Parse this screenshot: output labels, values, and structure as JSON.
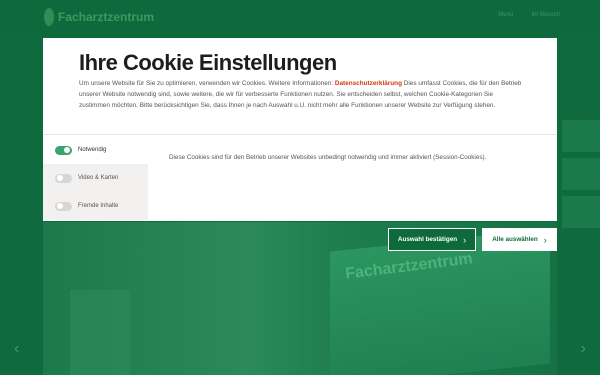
{
  "background": {
    "logo_text": "Facharztzentrum",
    "nav": [
      "Menü",
      "Ihr Besuch"
    ],
    "sign_text": "Facharztzentrum",
    "side_tabs": [
      "",
      "",
      ""
    ]
  },
  "modal": {
    "title": "Ihre Cookie Einstellungen",
    "desc_before_link": "Um unsere Website für Sie zu optimieren, verwenden wir Cookies. Weitere Informationen: ",
    "link_text": "Datenschutzerklärung",
    "desc_after_link": " Dies umfasst Cookies, die für den Betrieb unserer Website notwendig sind, sowie weitere, die wir für verbesserte Funktionen nutzen. Sie entscheiden selbst, welchen Cookie-Kategorien Sie zustimmen möchten. Bitte berücksichtigen Sie, dass Ihnen je nach Auswahl u.U. nicht mehr alle Funktionen unserer Website zur Verfügung stehen.",
    "categories": [
      {
        "label": "Notwendig",
        "enabled": true
      },
      {
        "label": "Video & Karten",
        "enabled": false
      },
      {
        "label": "Fremde Inhalte",
        "enabled": false
      }
    ],
    "detail_text": "Diese Cookies sind für den Betrieb unserer Websites unbedingt notwendig und immer aktiviert (Session-Cookies)."
  },
  "buttons": {
    "confirm_label": "Auswahl bestätigen",
    "all_label": "Alle auswählen",
    "chevron": "›"
  },
  "colors": {
    "brand_green": "#0d6a3b",
    "toggle_on": "#3aa470",
    "link": "#d4360f"
  }
}
